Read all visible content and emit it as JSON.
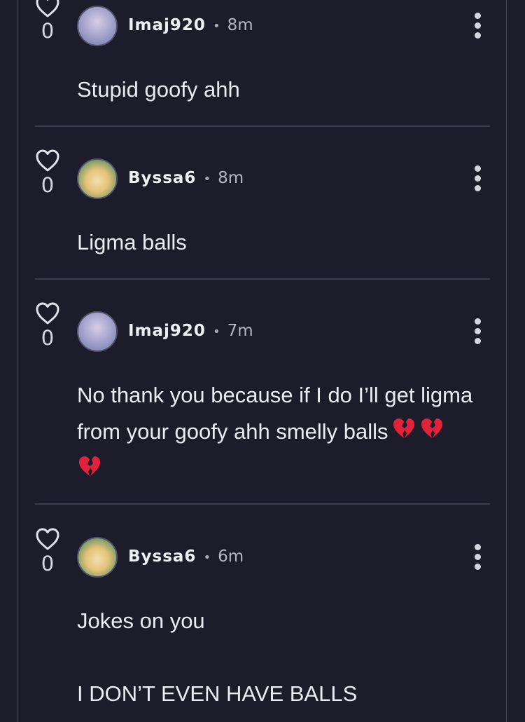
{
  "comments": [
    {
      "like_count": "0",
      "username": "Imaj920",
      "separator": "•",
      "time": "8m",
      "text": "Stupid goofy ahh",
      "avatar": "anime-avatar-lavender"
    },
    {
      "like_count": "0",
      "username": "Byssa6",
      "separator": "•",
      "time": "8m",
      "text": "Ligma balls",
      "avatar": "anime-avatar-blonde"
    },
    {
      "like_count": "0",
      "username": "Imaj920",
      "separator": "•",
      "time": "7m",
      "text_line1": "No thank you because if I do I’ll get ligma",
      "text_line2": "from your goofy ahh smelly balls",
      "emojis": [
        "broken-heart",
        "broken-heart",
        "broken-heart"
      ],
      "avatar": "anime-avatar-lavender"
    },
    {
      "like_count": "0",
      "username": "Byssa6",
      "separator": "•",
      "time": "6m",
      "text_line1": "Jokes on you",
      "text_line2": "I DON’T EVEN HAVE BALLS",
      "avatar": "anime-avatar-blonde"
    }
  ],
  "icons": {
    "like": "heart-outline-icon",
    "menu": "more-vertical-icon"
  },
  "colors": {
    "background": "#1d1c2a",
    "divider": "#3d3c4c",
    "text": "#ecebf3",
    "emoji": "#e0233b"
  }
}
